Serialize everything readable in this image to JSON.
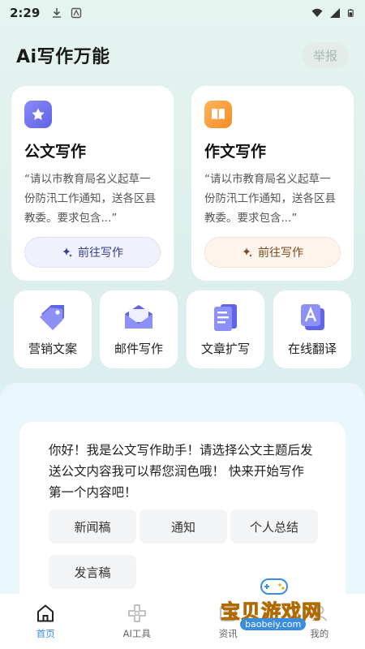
{
  "status_bar": {
    "time": "2:29"
  },
  "header": {
    "title": "Ai写作万能",
    "report_label": "举报"
  },
  "cards": [
    {
      "title": "公文写作",
      "description": "“请以市教育局名义起草一份防汛工作通知，送各区县教委。要求包含...”",
      "button_label": "前往写作",
      "icon": "star-icon",
      "accent": "#5e61e6"
    },
    {
      "title": "作文写作",
      "description": "“请以市教育局名义起草一份防汛工作通知，送各区县教委。要求包含...”",
      "button_label": "前往写作",
      "icon": "book-icon",
      "accent": "#f48b25"
    }
  ],
  "tools": [
    {
      "label": "营销文案",
      "icon": "tag-icon"
    },
    {
      "label": "邮件写作",
      "icon": "envelope-icon"
    },
    {
      "label": "文章扩写",
      "icon": "document-icon"
    },
    {
      "label": "在线翻译",
      "icon": "translate-icon"
    }
  ],
  "chat": {
    "message": "你好！我是公文写作助手！请选择公文主题后发送公文内容我可以帮您润色哦！ 快来开始写作第一个内容吧！",
    "chips": [
      "新闻稿",
      "通知",
      "个人总结",
      "发言稿"
    ]
  },
  "nav": [
    {
      "label": "首页",
      "icon": "home-icon",
      "active": true
    },
    {
      "label": "AI工具",
      "icon": "ai-tools-icon",
      "active": false
    },
    {
      "label": "资讯",
      "icon": "news-icon",
      "active": false
    },
    {
      "label": "我的",
      "icon": "profile-icon",
      "active": false
    }
  ],
  "watermark": {
    "text": "宝贝游戏网",
    "url": "baobeiy.com"
  }
}
